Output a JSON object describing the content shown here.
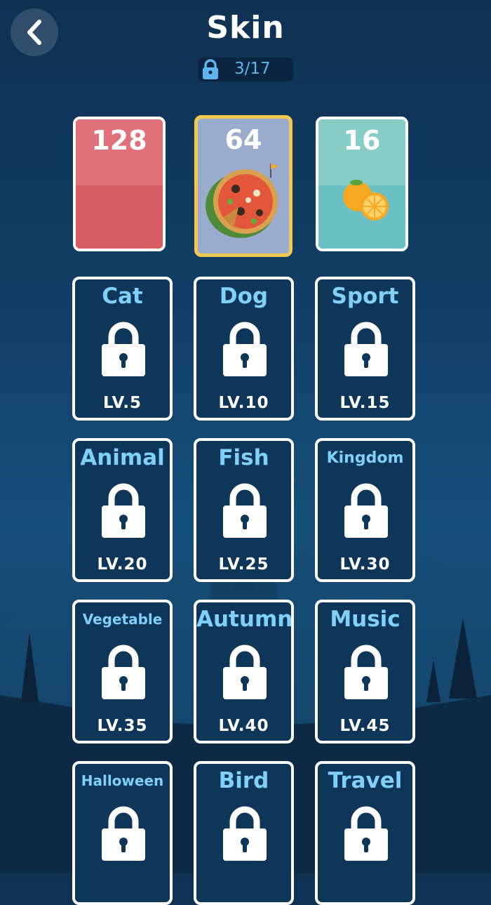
{
  "header": {
    "title": "Skin",
    "back_icon": "chevron-left-icon"
  },
  "progress": {
    "icon": "lock-icon",
    "text": "3/17",
    "unlocked": 3,
    "total": 17
  },
  "colors": {
    "accent": "#7fd0fb",
    "selected_border": "#f2c94c",
    "card_bg": "#0e3658"
  },
  "unlocked_skins": [
    {
      "value": "128",
      "theme": "red",
      "selected": false
    },
    {
      "value": "64",
      "theme": "pizza",
      "selected": true,
      "image": "pizza-image"
    },
    {
      "value": "16",
      "theme": "teal",
      "selected": false,
      "image": "orange-fruit-image"
    }
  ],
  "locked_skins": [
    {
      "name": "Cat",
      "level": "LV.5"
    },
    {
      "name": "Dog",
      "level": "LV.10"
    },
    {
      "name": "Sport",
      "level": "LV.15"
    },
    {
      "name": "Animal",
      "level": "LV.20"
    },
    {
      "name": "Fish",
      "level": "LV.25"
    },
    {
      "name": "Kingdom",
      "level": "LV.30"
    },
    {
      "name": "Vegetable",
      "level": "LV.35"
    },
    {
      "name": "Autumn",
      "level": "LV.40"
    },
    {
      "name": "Music",
      "level": "LV.45"
    },
    {
      "name": "Halloween",
      "level": ""
    },
    {
      "name": "Bird",
      "level": ""
    },
    {
      "name": "Travel",
      "level": ""
    }
  ]
}
